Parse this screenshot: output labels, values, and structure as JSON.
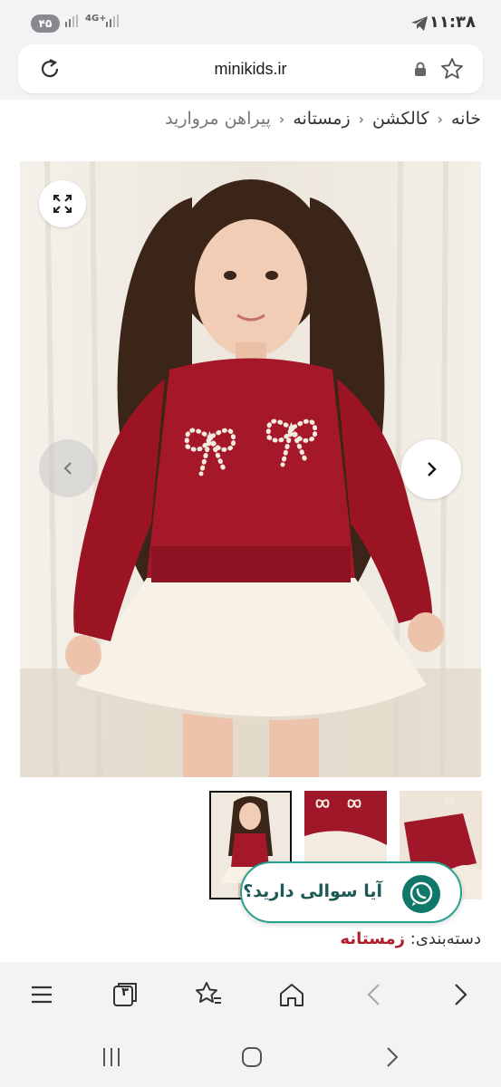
{
  "status_bar": {
    "battery": "۴۵",
    "signal_label": "4G+",
    "time": "۱۱:۳۸"
  },
  "browser": {
    "url": "minikids.ir"
  },
  "breadcrumb": {
    "items": [
      "خانه",
      "کالکشن",
      "زمستانه"
    ],
    "current": "پیراهن مروارید"
  },
  "product": {
    "category_label": "دسته‌بندی:",
    "category_value": "زمستانه"
  },
  "whatsapp": {
    "label": "آیا سوالی دارید؟"
  },
  "toolbar": {
    "tab_count": "۳"
  },
  "icons": {
    "reload": "reload-icon",
    "lock": "lock-icon",
    "bookmark": "star-icon",
    "expand": "expand-icon",
    "prev": "chevron-left-icon",
    "next": "chevron-right-icon",
    "whatsapp": "whatsapp-icon",
    "menu": "menu-icon",
    "tabs": "tabs-icon",
    "favorites": "favorites-icon",
    "home": "home-icon",
    "back": "back-icon",
    "forward": "forward-icon"
  },
  "colors": {
    "accent": "#b01e2c",
    "whatsapp_green": "#10786b",
    "sweater": "#9b1424",
    "chrome_bg": "#f3f3f6"
  }
}
